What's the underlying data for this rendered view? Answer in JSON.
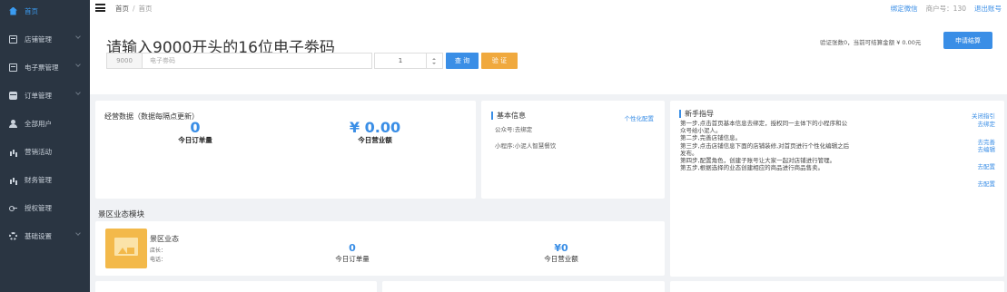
{
  "sidebar": {
    "items": [
      {
        "label": "首页",
        "icon": "home-icon"
      },
      {
        "label": "店铺管理",
        "icon": "store-icon"
      },
      {
        "label": "电子票管理",
        "icon": "ticket-icon"
      },
      {
        "label": "订单管理",
        "icon": "order-icon"
      },
      {
        "label": "全部用户",
        "icon": "users-icon"
      },
      {
        "label": "营销活动",
        "icon": "chart-icon"
      },
      {
        "label": "财务管理",
        "icon": "chart-icon"
      },
      {
        "label": "授权管理",
        "icon": "key-icon"
      },
      {
        "label": "基础设置",
        "icon": "gear-icon"
      }
    ],
    "active_color": "#3a9cf2",
    "bg_color": "#2a3542"
  },
  "header": {
    "breadcrumb": [
      "首页",
      "首页"
    ],
    "bind_wechat": "绑定微信",
    "account": "商户号：130",
    "logout": "退出账号"
  },
  "voucher": {
    "title": "请输入9000开头的16位电子劵码",
    "prefix": "9000",
    "code_placeholder": "电子劵码",
    "quantity": "1",
    "query_label": "查 询",
    "verify_label": "验 证",
    "info": "验证张数0，当前可结算金额 ¥ 0.00元",
    "settle_label": "申请结算"
  },
  "stats": {
    "title": "经营数据（数据每隔点更新）",
    "orders_value": "0",
    "orders_label": "今日订单量",
    "revenue_value": "¥ 0.00",
    "revenue_label": "今日营业额"
  },
  "basic_info": {
    "title": "基本信息",
    "personalize": "个性化配置",
    "account": "公众号:去绑定",
    "miniapp": "小程序:小泥人智慧餐饮"
  },
  "guide": {
    "title": "新手指导",
    "close": "关闭指引",
    "steps": [
      "第一步,点击首页基本信息去绑定，授权同一主体下的小程序和公众号给小泥人。",
      "第二步,完善店铺信息。",
      "第三步,点击店铺信息下面的店铺装修,对首页进行个性化编辑之后发布。",
      "第四步,配置角色，创建子账号让大家一起对店铺进行管理。",
      "第五步,根据选择的业态创建相应的商品进行商品售卖。"
    ],
    "actions": [
      "去绑定",
      "去完善",
      "去编辑",
      "去配置",
      "去配置"
    ]
  },
  "scenic": {
    "section_title": "景区业态模块",
    "name": "景区业态",
    "manager": "店长：",
    "phone": "电话：",
    "orders_value": "0",
    "orders_label": "今日订单量",
    "revenue_value": "¥0",
    "revenue_label": "今日营业额"
  },
  "colors": {
    "accent": "#3a8ee6",
    "verify": "#f0a93e"
  }
}
